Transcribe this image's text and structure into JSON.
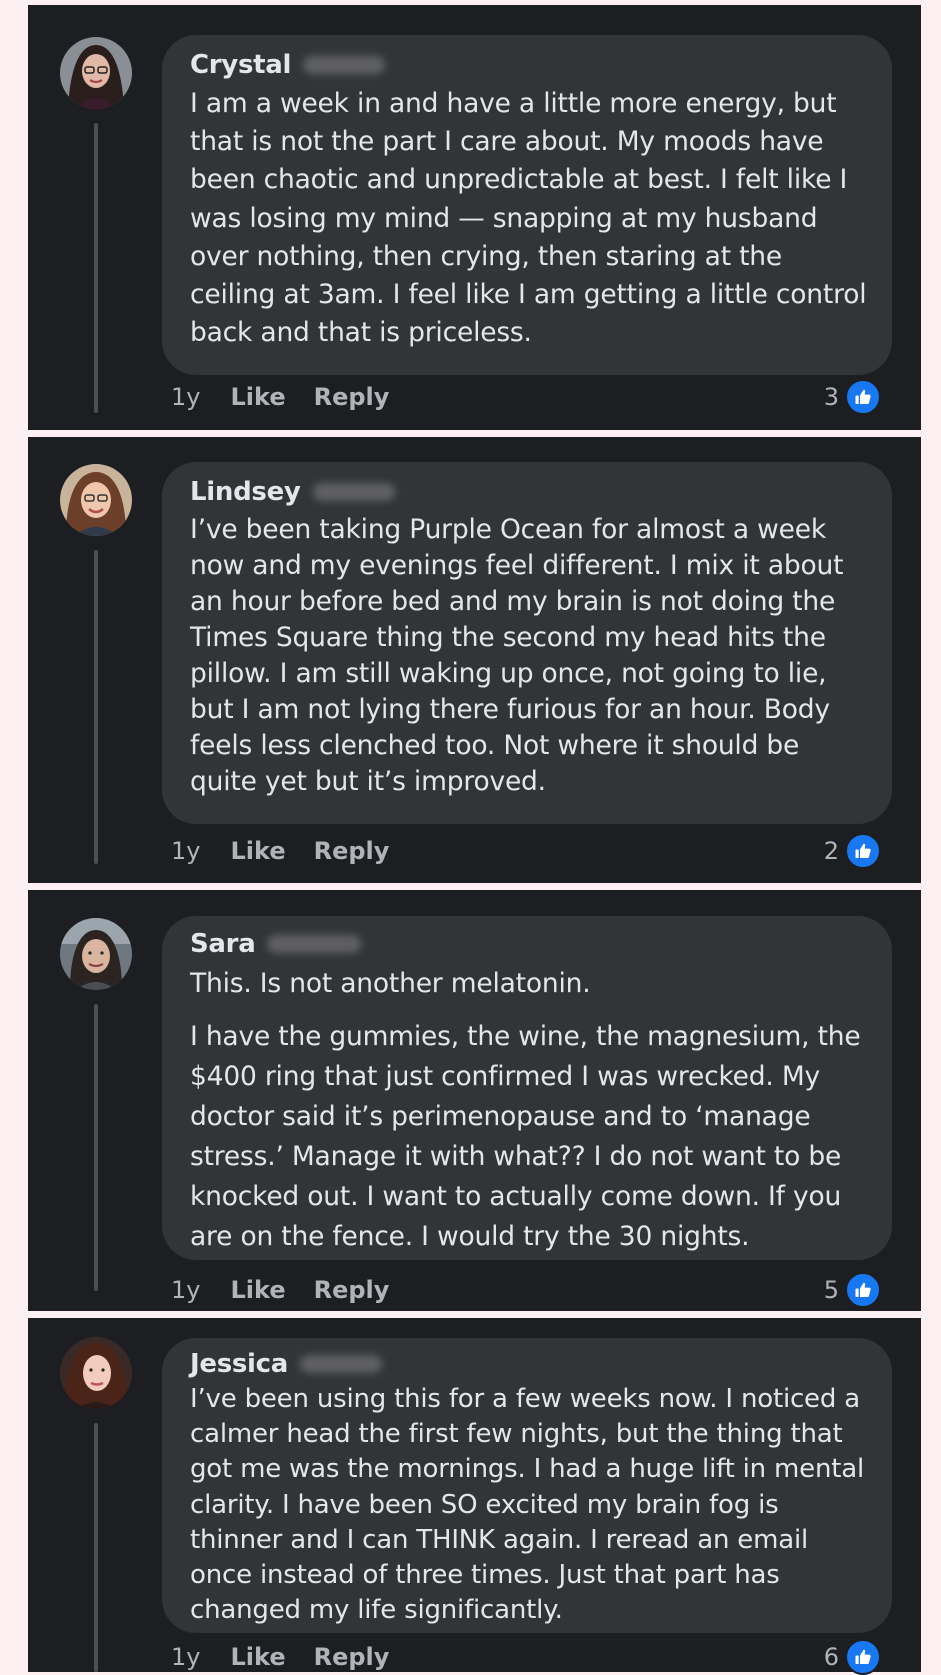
{
  "comments": [
    {
      "author": "Crystal",
      "paragraphs": [
        "I am a week in and have a little more energy, but that is not the part I care about. My moods have been chaotic and unpredictable at best. I felt like I was losing my mind — snapping at my husband over nothing, then crying, then staring at the ceiling at 3am. I feel like I am getting a little control back and that is priceless."
      ],
      "time": "1y",
      "like_label": "Like",
      "reply_label": "Reply",
      "reaction_count": "3"
    },
    {
      "author": "Lindsey",
      "paragraphs": [
        "I’ve been taking Purple Ocean for almost a week now and my evenings feel different. I mix it about an hour before bed and my brain is not doing the Times Square thing the second my head hits the pillow. I am still waking up once, not going to lie, but I am not lying there furious for an hour. Body feels less clenched too. Not where it should be quite yet but it’s improved."
      ],
      "time": "1y",
      "like_label": "Like",
      "reply_label": "Reply",
      "reaction_count": "2"
    },
    {
      "author": "Sara",
      "paragraphs": [
        "This. Is not another melatonin.",
        "I have the gummies, the wine, the magnesium, the $400 ring that just confirmed I was wrecked. My doctor said it’s perimenopause and to ‘manage stress.’ Manage it with what?? I do not want to be knocked out. I want to actually come down. If you are on the fence. I would try the 30 nights."
      ],
      "time": "1y",
      "like_label": "Like",
      "reply_label": "Reply",
      "reaction_count": "5"
    },
    {
      "author": "Jessica",
      "paragraphs": [
        "I’ve been using this for a few weeks now. I noticed a calmer head the first few nights, but the thing that got me was the mornings. I had a huge lift in mental clarity. I have been SO excited my brain fog is thinner and I can THINK again. I reread an email once instead of three times. Just that part has changed my life significantly."
      ],
      "time": "1y",
      "like_label": "Like",
      "reply_label": "Reply",
      "reaction_count": "6"
    }
  ],
  "icons": {
    "reaction": "thumbs-up-icon",
    "reaction_color": "#1877f2"
  }
}
